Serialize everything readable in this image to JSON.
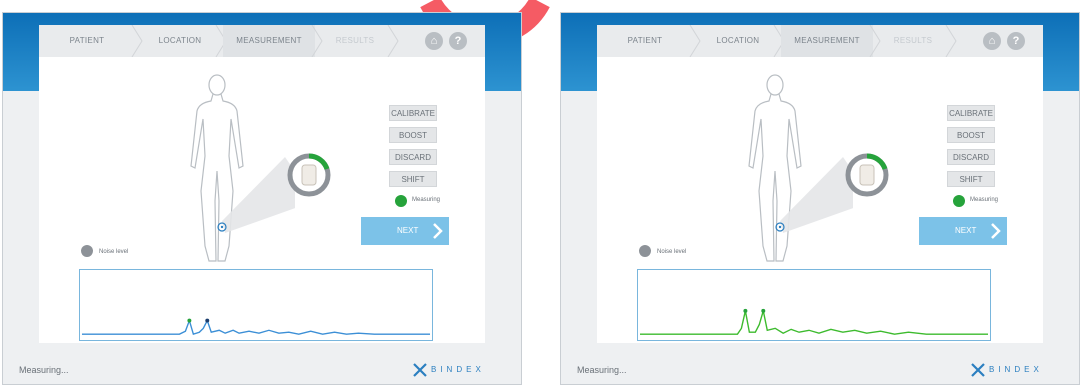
{
  "screens": [
    {
      "breadcrumb": [
        "PATIENT",
        "LOCATION",
        "MEASUREMENT",
        "RESULTS"
      ],
      "active_step": "MEASUREMENT",
      "header_icons": [
        "home-icon",
        "help-icon"
      ],
      "buttons": [
        "CALIBRATE",
        "BOOST",
        "DISCARD",
        "SHIFT"
      ],
      "status": {
        "label": "Measuring",
        "color": "#26a33b"
      },
      "next_label": "NEXT",
      "noise_label": "Noise level",
      "signal_color": "#3c8fd6",
      "footer_text": "Measuring...",
      "brand": "BINDEX"
    },
    {
      "breadcrumb": [
        "PATIENT",
        "LOCATION",
        "MEASUREMENT",
        "RESULTS"
      ],
      "active_step": "MEASUREMENT",
      "header_icons": [
        "home-icon",
        "help-icon"
      ],
      "buttons": [
        "CALIBRATE",
        "BOOST",
        "DISCARD",
        "SHIFT"
      ],
      "status": {
        "label": "Measuring",
        "color": "#26a33b"
      },
      "next_label": "NEXT",
      "noise_label": "Noise level",
      "signal_color": "#3dbb2e",
      "footer_text": "Measuring...",
      "brand": "BINDEX"
    }
  ],
  "colors": {
    "header_blue": "#1a80c6",
    "accent_green": "#26a33b",
    "next_blue": "#7cc2e8",
    "connector_arc": "#f55b64"
  }
}
